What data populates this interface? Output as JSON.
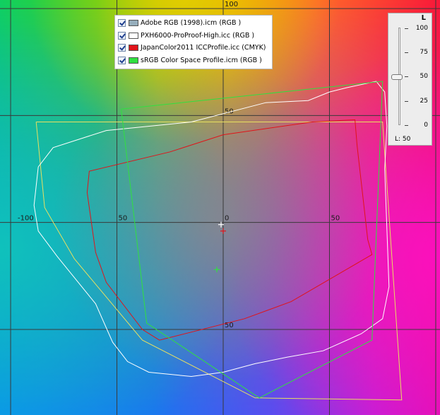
{
  "chart_data": {
    "type": "scatter",
    "plot_kind": "CIELAB a*-b* gamut comparison",
    "xlim": [
      -105,
      102
    ],
    "ylim": [
      -90,
      104
    ],
    "grid": true,
    "grid_step": 50,
    "tick_labels": [
      {
        "axis": "y",
        "value": 100,
        "text": "100"
      },
      {
        "axis": "y",
        "value": 50,
        "text": "50"
      },
      {
        "axis": "y",
        "value": -50,
        "text": "50"
      },
      {
        "axis": "x",
        "value": -100,
        "text": "-100"
      },
      {
        "axis": "x",
        "value": -50,
        "text": "50"
      },
      {
        "axis": "x",
        "value": 0,
        "text": "0"
      },
      {
        "axis": "x",
        "value": 50,
        "text": "50"
      }
    ],
    "series": [
      {
        "name": "Adobe RGB (1998).icm (RGB )",
        "color": "#e8e060",
        "points": [
          [
            -88,
            47
          ],
          [
            75,
            47
          ],
          [
            84,
            -83
          ],
          [
            15,
            -82
          ],
          [
            -38,
            -55
          ],
          [
            -70,
            -17
          ],
          [
            -84,
            7
          ],
          [
            -88,
            47
          ]
        ]
      },
      {
        "name": "PXH6000-ProProof-High.icc (RGB )",
        "color": "#ffffff",
        "points": [
          [
            -87,
            26
          ],
          [
            -80,
            35
          ],
          [
            -55,
            43
          ],
          [
            -15,
            47
          ],
          [
            20,
            56
          ],
          [
            40,
            57
          ],
          [
            50,
            61
          ],
          [
            58,
            63
          ],
          [
            72,
            66
          ],
          [
            76,
            61
          ],
          [
            77,
            45
          ],
          [
            76,
            25
          ],
          [
            78,
            -30
          ],
          [
            75,
            -45
          ],
          [
            65,
            -52
          ],
          [
            47,
            -60
          ],
          [
            30,
            -63
          ],
          [
            15,
            -66
          ],
          [
            0,
            -70
          ],
          [
            -15,
            -72
          ],
          [
            -35,
            -70
          ],
          [
            -45,
            -65
          ],
          [
            -52,
            -56
          ],
          [
            -60,
            -38
          ],
          [
            -78,
            -16
          ],
          [
            -87,
            -4
          ],
          [
            -89,
            8
          ],
          [
            -87,
            26
          ]
        ]
      },
      {
        "name": "JapanColor2011 ICCProfile.icc (CMYK)",
        "color": "#e0141a",
        "points": [
          [
            -63,
            24
          ],
          [
            -25,
            33
          ],
          [
            0,
            41
          ],
          [
            42,
            47
          ],
          [
            62,
            48
          ],
          [
            63,
            36
          ],
          [
            68,
            -8
          ],
          [
            70,
            -15
          ],
          [
            32,
            -37
          ],
          [
            10,
            -45
          ],
          [
            -30,
            -55
          ],
          [
            -38,
            -50
          ],
          [
            -55,
            -28
          ],
          [
            -60,
            -14
          ],
          [
            -64,
            14
          ],
          [
            -63,
            24
          ]
        ]
      },
      {
        "name": "sRGB Color Space Profile.icm (RGB )",
        "color": "#30e040",
        "points": [
          [
            -48,
            53
          ],
          [
            75,
            66
          ],
          [
            70,
            -55
          ],
          [
            17,
            -82
          ],
          [
            -36,
            -47
          ],
          [
            -48,
            53
          ]
        ]
      }
    ],
    "markers": [
      {
        "name": "white point",
        "a": -1,
        "b": -1,
        "color": "#ffffff"
      },
      {
        "name": "white point",
        "a": 0,
        "b": -4,
        "color": "#e0141a"
      },
      {
        "name": "white point",
        "a": -3,
        "b": -22,
        "color": "#30e040"
      }
    ]
  },
  "legend": {
    "items": [
      {
        "label": "Adobe RGB (1998).icm (RGB )",
        "swatch": "#96aebc",
        "checked": true
      },
      {
        "label": "PXH6000-ProProof-High.icc (RGB )",
        "swatch": "#ffffff",
        "checked": true
      },
      {
        "label": "JapanColor2011 ICCProfile.icc (CMYK)",
        "swatch": "#e0141a",
        "checked": true
      },
      {
        "label": "sRGB Color Space Profile.icm (RGB )",
        "swatch": "#30e040",
        "checked": true
      }
    ]
  },
  "lightness_panel": {
    "title": "L",
    "value": 50,
    "readout": "L: 50",
    "ticks": [
      "100",
      "75",
      "50",
      "25",
      "0"
    ]
  }
}
